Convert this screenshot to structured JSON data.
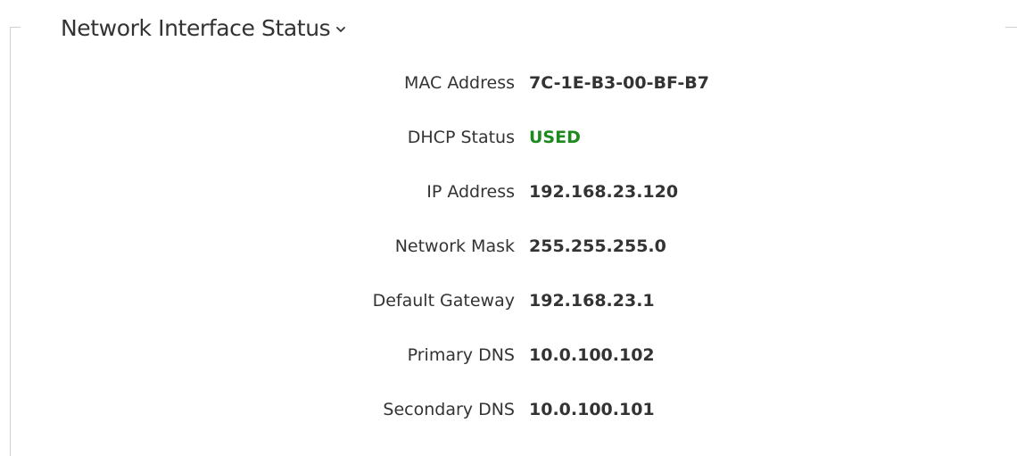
{
  "section": {
    "title": "Network Interface Status",
    "expand_icon": "chevron-down-icon"
  },
  "colors": {
    "text": "#333333",
    "status_used": "#1e8a1e",
    "frame": "#d0d0d0"
  },
  "fields": [
    {
      "label": "MAC Address",
      "value": "7C-1E-B3-00-BF-B7"
    },
    {
      "label": "DHCP Status",
      "value": "USED"
    },
    {
      "label": "IP Address",
      "value": "192.168.23.120"
    },
    {
      "label": "Network Mask",
      "value": "255.255.255.0"
    },
    {
      "label": "Default Gateway",
      "value": "192.168.23.1"
    },
    {
      "label": "Primary DNS",
      "value": "10.0.100.102"
    },
    {
      "label": "Secondary DNS",
      "value": "10.0.100.101"
    }
  ]
}
